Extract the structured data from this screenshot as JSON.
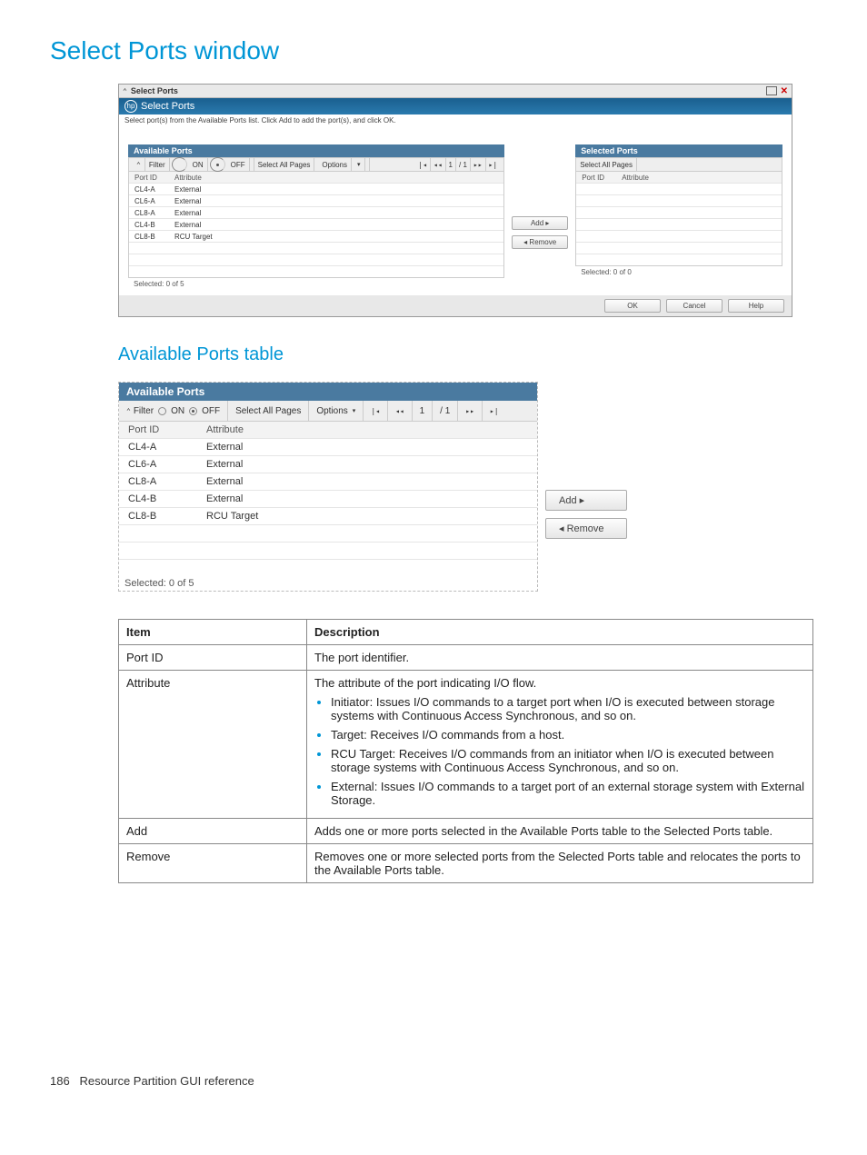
{
  "page_title": "Select Ports window",
  "titlebar": "Select Ports",
  "dialog_header": "Select Ports",
  "instruction": "Select port(s) from the Available Ports list. Click Add to add the port(s), and click OK.",
  "available": {
    "title": "Available Ports",
    "filter_label": "Filter",
    "on": "ON",
    "off": "OFF",
    "select_all": "Select All Pages",
    "options": "Options",
    "page_cur": "1",
    "page_total": "/ 1",
    "cols": {
      "c1": "Port ID",
      "c2": "Attribute"
    },
    "rows": [
      {
        "id": "CL4-A",
        "attr": "External"
      },
      {
        "id": "CL6-A",
        "attr": "External"
      },
      {
        "id": "CL8-A",
        "attr": "External"
      },
      {
        "id": "CL4-B",
        "attr": "External"
      },
      {
        "id": "CL8-B",
        "attr": "RCU Target"
      }
    ],
    "selected_text": "Selected:  0   of  5"
  },
  "selected": {
    "title": "Selected Ports",
    "select_all": "Select All Pages",
    "cols": {
      "c1": "Port ID",
      "c2": "Attribute"
    },
    "selected_text": "Selected:  0   of  0"
  },
  "mid": {
    "add": "Add ▸",
    "remove": "◂ Remove"
  },
  "dlg": {
    "ok": "OK",
    "cancel": "Cancel",
    "help": "Help"
  },
  "section2_title": "Available Ports table",
  "big": {
    "title": "Available Ports",
    "filter_label": "Filter",
    "on": "ON",
    "off": "OFF",
    "select_all": "Select All Pages",
    "options": "Options",
    "page_cur": "1",
    "page_total": "/ 1",
    "cols": {
      "c1": "Port ID",
      "c2": "Attribute"
    },
    "rows": [
      {
        "id": "CL4-A",
        "attr": "External"
      },
      {
        "id": "CL6-A",
        "attr": "External"
      },
      {
        "id": "CL8-A",
        "attr": "External"
      },
      {
        "id": "CL4-B",
        "attr": "External"
      },
      {
        "id": "CL8-B",
        "attr": "RCU Target"
      }
    ],
    "selected_text": "Selected:  0   of  5",
    "add": "Add ▸",
    "remove": "◂ Remove"
  },
  "desc": {
    "h_item": "Item",
    "h_desc": "Description",
    "rows": {
      "portid": {
        "item": "Port ID",
        "desc": "The port identifier."
      },
      "attribute": {
        "item": "Attribute",
        "lead": "The attribute of the port indicating I/O flow.",
        "b1": "Initiator: Issues I/O commands to a target port when I/O is executed between storage systems with Continuous Access Synchronous, and so on.",
        "b2": "Target: Receives I/O commands from a host.",
        "b3": "RCU Target: Receives I/O commands from an initiator when I/O is executed between storage systems with Continuous Access Synchronous, and so on.",
        "b4": "External: Issues I/O commands to a target port of an external storage system with External Storage."
      },
      "add": {
        "item": "Add",
        "desc": "Adds one or more ports selected in the Available Ports table to the Selected Ports table."
      },
      "remove": {
        "item": "Remove",
        "desc": "Removes one or more selected ports from the Selected Ports table and relocates the ports to the Available Ports table."
      }
    }
  },
  "footer": {
    "page": "186",
    "text": "Resource Partition GUI reference"
  }
}
